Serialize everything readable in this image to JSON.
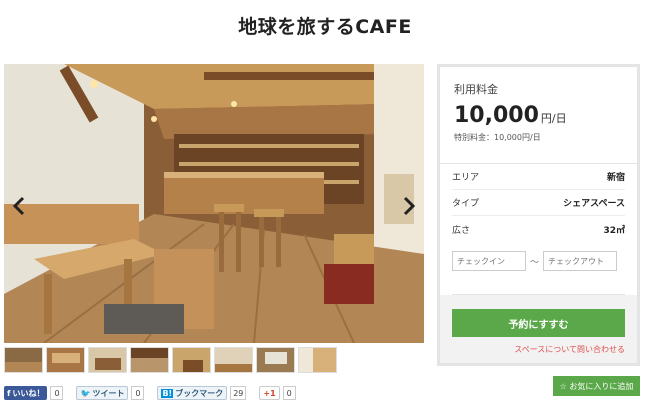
{
  "title": "地球を旅するCAFE",
  "gallery": {
    "prev_icon": "chevron-left-icon",
    "next_icon": "chevron-right-icon",
    "thumbnail_count": 8
  },
  "pricing": {
    "label": "利用料金",
    "amount": "10,000",
    "unit": "円/日",
    "special": "特別料金：10,000円/日"
  },
  "details": [
    {
      "label": "エリア",
      "value": "新宿"
    },
    {
      "label": "タイプ",
      "value": "シェアスペース"
    },
    {
      "label": "広さ",
      "value": "32㎡"
    }
  ],
  "dates": {
    "checkin_placeholder": "チェックイン",
    "separator": "〜",
    "checkout_placeholder": "チェックアウト"
  },
  "reserve_label": "予約にすすむ",
  "inquiry_label": "スペースについて問い合わせる",
  "favorite_label": "☆ お気に入りに追加",
  "social": {
    "facebook_label": "いいね！",
    "facebook_count": "0",
    "tweet_label": "ツイート",
    "tweet_count": "0",
    "hatena_label": "ブックマーク",
    "hatena_count": "29",
    "gplus_label": "+1",
    "gplus_count": "0"
  },
  "colors": {
    "accent_green": "#5ba84a",
    "inquiry_red": "#e05050",
    "facebook_blue": "#3b5998"
  }
}
